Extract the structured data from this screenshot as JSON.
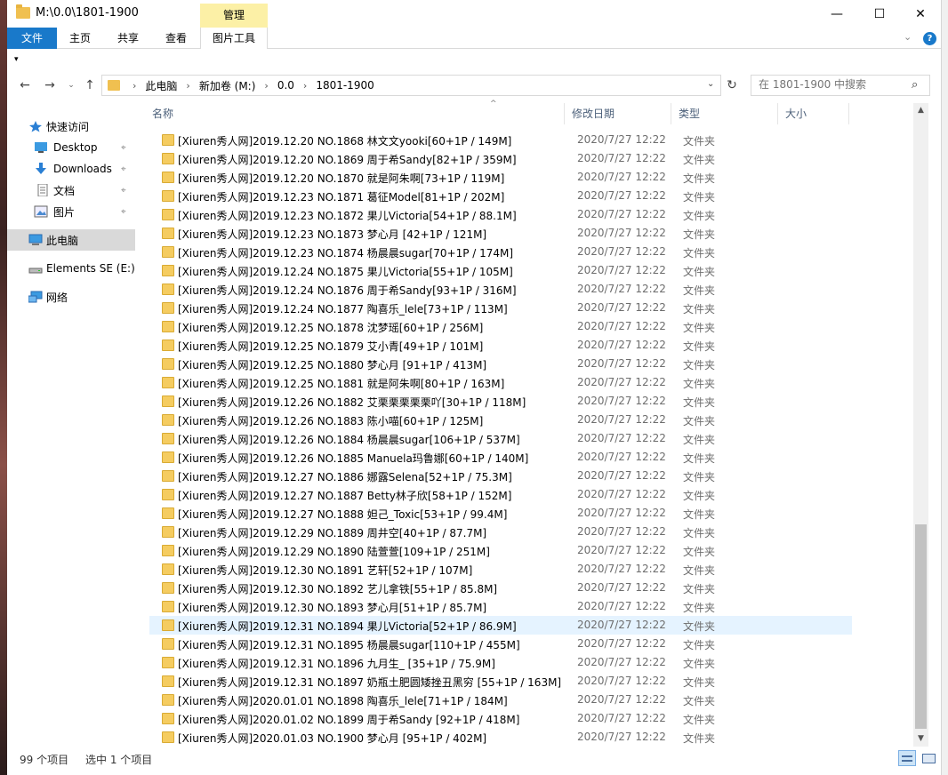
{
  "window": {
    "title": "M:\\0.0\\1801-1900",
    "minimize": "—",
    "maximize": "☐",
    "close": "✕"
  },
  "ribbon": {
    "manage_label": "管理",
    "tabs": {
      "file": "文件",
      "home": "主页",
      "share": "共享",
      "view": "查看",
      "picture_tools": "图片工具"
    },
    "expand": "⌄",
    "help": "?"
  },
  "qat": {
    "customize": "▾"
  },
  "nav": {
    "back": "←",
    "forward": "→",
    "recent": "⌄",
    "up": "↑",
    "breadcrumbs": [
      "此电脑",
      "新加卷 (M:)",
      "0.0",
      "1801-1900"
    ],
    "crumb_sep": "›",
    "address_dropdown": "⌄",
    "refresh": "↻",
    "search_placeholder": "在 1801-1900 中搜索",
    "search_icon": "⌕"
  },
  "sidebar": {
    "items": [
      {
        "label": "快速访问",
        "icon": "star-icon",
        "pinned": false
      },
      {
        "label": "Desktop",
        "icon": "desktop-icon",
        "pinned": true
      },
      {
        "label": "Downloads",
        "icon": "download-icon",
        "pinned": true
      },
      {
        "label": "文档",
        "icon": "document-icon",
        "pinned": true
      },
      {
        "label": "图片",
        "icon": "picture-icon",
        "pinned": true
      },
      {
        "label": "此电脑",
        "icon": "computer-icon",
        "pinned": false
      },
      {
        "label": "Elements SE (E:)",
        "icon": "drive-icon",
        "pinned": false
      },
      {
        "label": "网络",
        "icon": "network-icon",
        "pinned": false
      }
    ],
    "pin_glyph": "📌"
  },
  "columns": {
    "name": "名称",
    "date": "修改日期",
    "type": "类型",
    "size": "大小",
    "sort_arrow": "^"
  },
  "files": [
    {
      "name": "[Xiuren秀人网]2019.12.20 NO.1868 林文文yooki[60+1P / 149M]",
      "date": "2020/7/27 12:22",
      "type": "文件夹"
    },
    {
      "name": "[Xiuren秀人网]2019.12.20 NO.1869 周于希Sandy[82+1P / 359M]",
      "date": "2020/7/27 12:22",
      "type": "文件夹"
    },
    {
      "name": "[Xiuren秀人网]2019.12.20 NO.1870 就是阿朱啊[73+1P / 119M]",
      "date": "2020/7/27 12:22",
      "type": "文件夹"
    },
    {
      "name": "[Xiuren秀人网]2019.12.23 NO.1871 葛征Model[81+1P / 202M]",
      "date": "2020/7/27 12:22",
      "type": "文件夹"
    },
    {
      "name": "[Xiuren秀人网]2019.12.23 NO.1872 果儿Victoria[54+1P / 88.1M]",
      "date": "2020/7/27 12:22",
      "type": "文件夹"
    },
    {
      "name": "[Xiuren秀人网]2019.12.23 NO.1873 梦心月 [42+1P / 121M]",
      "date": "2020/7/27 12:22",
      "type": "文件夹"
    },
    {
      "name": "[Xiuren秀人网]2019.12.23 NO.1874 杨晨晨sugar[70+1P / 174M]",
      "date": "2020/7/27 12:22",
      "type": "文件夹"
    },
    {
      "name": "[Xiuren秀人网]2019.12.24 NO.1875 果儿Victoria[55+1P / 105M]",
      "date": "2020/7/27 12:22",
      "type": "文件夹"
    },
    {
      "name": "[Xiuren秀人网]2019.12.24 NO.1876 周于希Sandy[93+1P / 316M]",
      "date": "2020/7/27 12:22",
      "type": "文件夹"
    },
    {
      "name": "[Xiuren秀人网]2019.12.24 NO.1877 陶喜乐_lele[73+1P / 113M]",
      "date": "2020/7/27 12:22",
      "type": "文件夹"
    },
    {
      "name": "[Xiuren秀人网]2019.12.25 NO.1878 沈梦瑶[60+1P / 256M]",
      "date": "2020/7/27 12:22",
      "type": "文件夹"
    },
    {
      "name": "[Xiuren秀人网]2019.12.25 NO.1879 艾小青[49+1P / 101M]",
      "date": "2020/7/27 12:22",
      "type": "文件夹"
    },
    {
      "name": "[Xiuren秀人网]2019.12.25 NO.1880 梦心月 [91+1P / 413M]",
      "date": "2020/7/27 12:22",
      "type": "文件夹"
    },
    {
      "name": "[Xiuren秀人网]2019.12.25 NO.1881 就是阿朱啊[80+1P / 163M]",
      "date": "2020/7/27 12:22",
      "type": "文件夹"
    },
    {
      "name": "[Xiuren秀人网]2019.12.26 NO.1882 艾栗栗栗栗栗吖[30+1P / 118M]",
      "date": "2020/7/27 12:22",
      "type": "文件夹"
    },
    {
      "name": "[Xiuren秀人网]2019.12.26 NO.1883 陈小喵[60+1P / 125M]",
      "date": "2020/7/27 12:22",
      "type": "文件夹"
    },
    {
      "name": "[Xiuren秀人网]2019.12.26 NO.1884 杨晨晨sugar[106+1P / 537M]",
      "date": "2020/7/27 12:22",
      "type": "文件夹"
    },
    {
      "name": "[Xiuren秀人网]2019.12.26 NO.1885 Manuela玛鲁娜[60+1P / 140M]",
      "date": "2020/7/27 12:22",
      "type": "文件夹"
    },
    {
      "name": "[Xiuren秀人网]2019.12.27 NO.1886 娜露Selena[52+1P / 75.3M]",
      "date": "2020/7/27 12:22",
      "type": "文件夹"
    },
    {
      "name": "[Xiuren秀人网]2019.12.27 NO.1887 Betty林子欣[58+1P / 152M]",
      "date": "2020/7/27 12:22",
      "type": "文件夹"
    },
    {
      "name": "[Xiuren秀人网]2019.12.27 NO.1888 妲己_Toxic[53+1P / 99.4M]",
      "date": "2020/7/27 12:22",
      "type": "文件夹"
    },
    {
      "name": "[Xiuren秀人网]2019.12.29 NO.1889 周井空[40+1P / 87.7M]",
      "date": "2020/7/27 12:22",
      "type": "文件夹"
    },
    {
      "name": "[Xiuren秀人网]2019.12.29 NO.1890 陆萱萱[109+1P / 251M]",
      "date": "2020/7/27 12:22",
      "type": "文件夹"
    },
    {
      "name": "[Xiuren秀人网]2019.12.30 NO.1891 艺轩[52+1P / 107M]",
      "date": "2020/7/27 12:22",
      "type": "文件夹"
    },
    {
      "name": "[Xiuren秀人网]2019.12.30 NO.1892 艺儿拿铁[55+1P / 85.8M]",
      "date": "2020/7/27 12:22",
      "type": "文件夹"
    },
    {
      "name": "[Xiuren秀人网]2019.12.30 NO.1893 梦心月[51+1P / 85.7M]",
      "date": "2020/7/27 12:22",
      "type": "文件夹"
    },
    {
      "name": "[Xiuren秀人网]2019.12.31 NO.1894 果儿Victoria[52+1P / 86.9M]",
      "date": "2020/7/27 12:22",
      "type": "文件夹",
      "selected": true
    },
    {
      "name": "[Xiuren秀人网]2019.12.31 NO.1895 杨晨晨sugar[110+1P / 455M]",
      "date": "2020/7/27 12:22",
      "type": "文件夹"
    },
    {
      "name": "[Xiuren秀人网]2019.12.31 NO.1896 九月生_ [35+1P / 75.9M]",
      "date": "2020/7/27 12:22",
      "type": "文件夹"
    },
    {
      "name": "[Xiuren秀人网]2019.12.31 NO.1897 奶瓶土肥圆矮挫丑黑穷 [55+1P / 163M]",
      "date": "2020/7/27 12:22",
      "type": "文件夹"
    },
    {
      "name": "[Xiuren秀人网]2020.01.01 NO.1898 陶喜乐_lele[71+1P / 184M]",
      "date": "2020/7/27 12:22",
      "type": "文件夹"
    },
    {
      "name": "[Xiuren秀人网]2020.01.02 NO.1899 周于希Sandy [92+1P / 418M]",
      "date": "2020/7/27 12:22",
      "type": "文件夹"
    },
    {
      "name": "[Xiuren秀人网]2020.01.03 NO.1900 梦心月 [95+1P / 402M]",
      "date": "2020/7/27 12:22",
      "type": "文件夹"
    }
  ],
  "scrollbar": {
    "up": "▲",
    "down": "▼"
  },
  "status": {
    "count": "99 个项目",
    "selection": "选中 1 个项目"
  },
  "colors": {
    "accent": "#1979ca",
    "manage_tab": "#fcf0a6",
    "selected_row": "#e5f3ff",
    "folder": "#f5cc60"
  }
}
